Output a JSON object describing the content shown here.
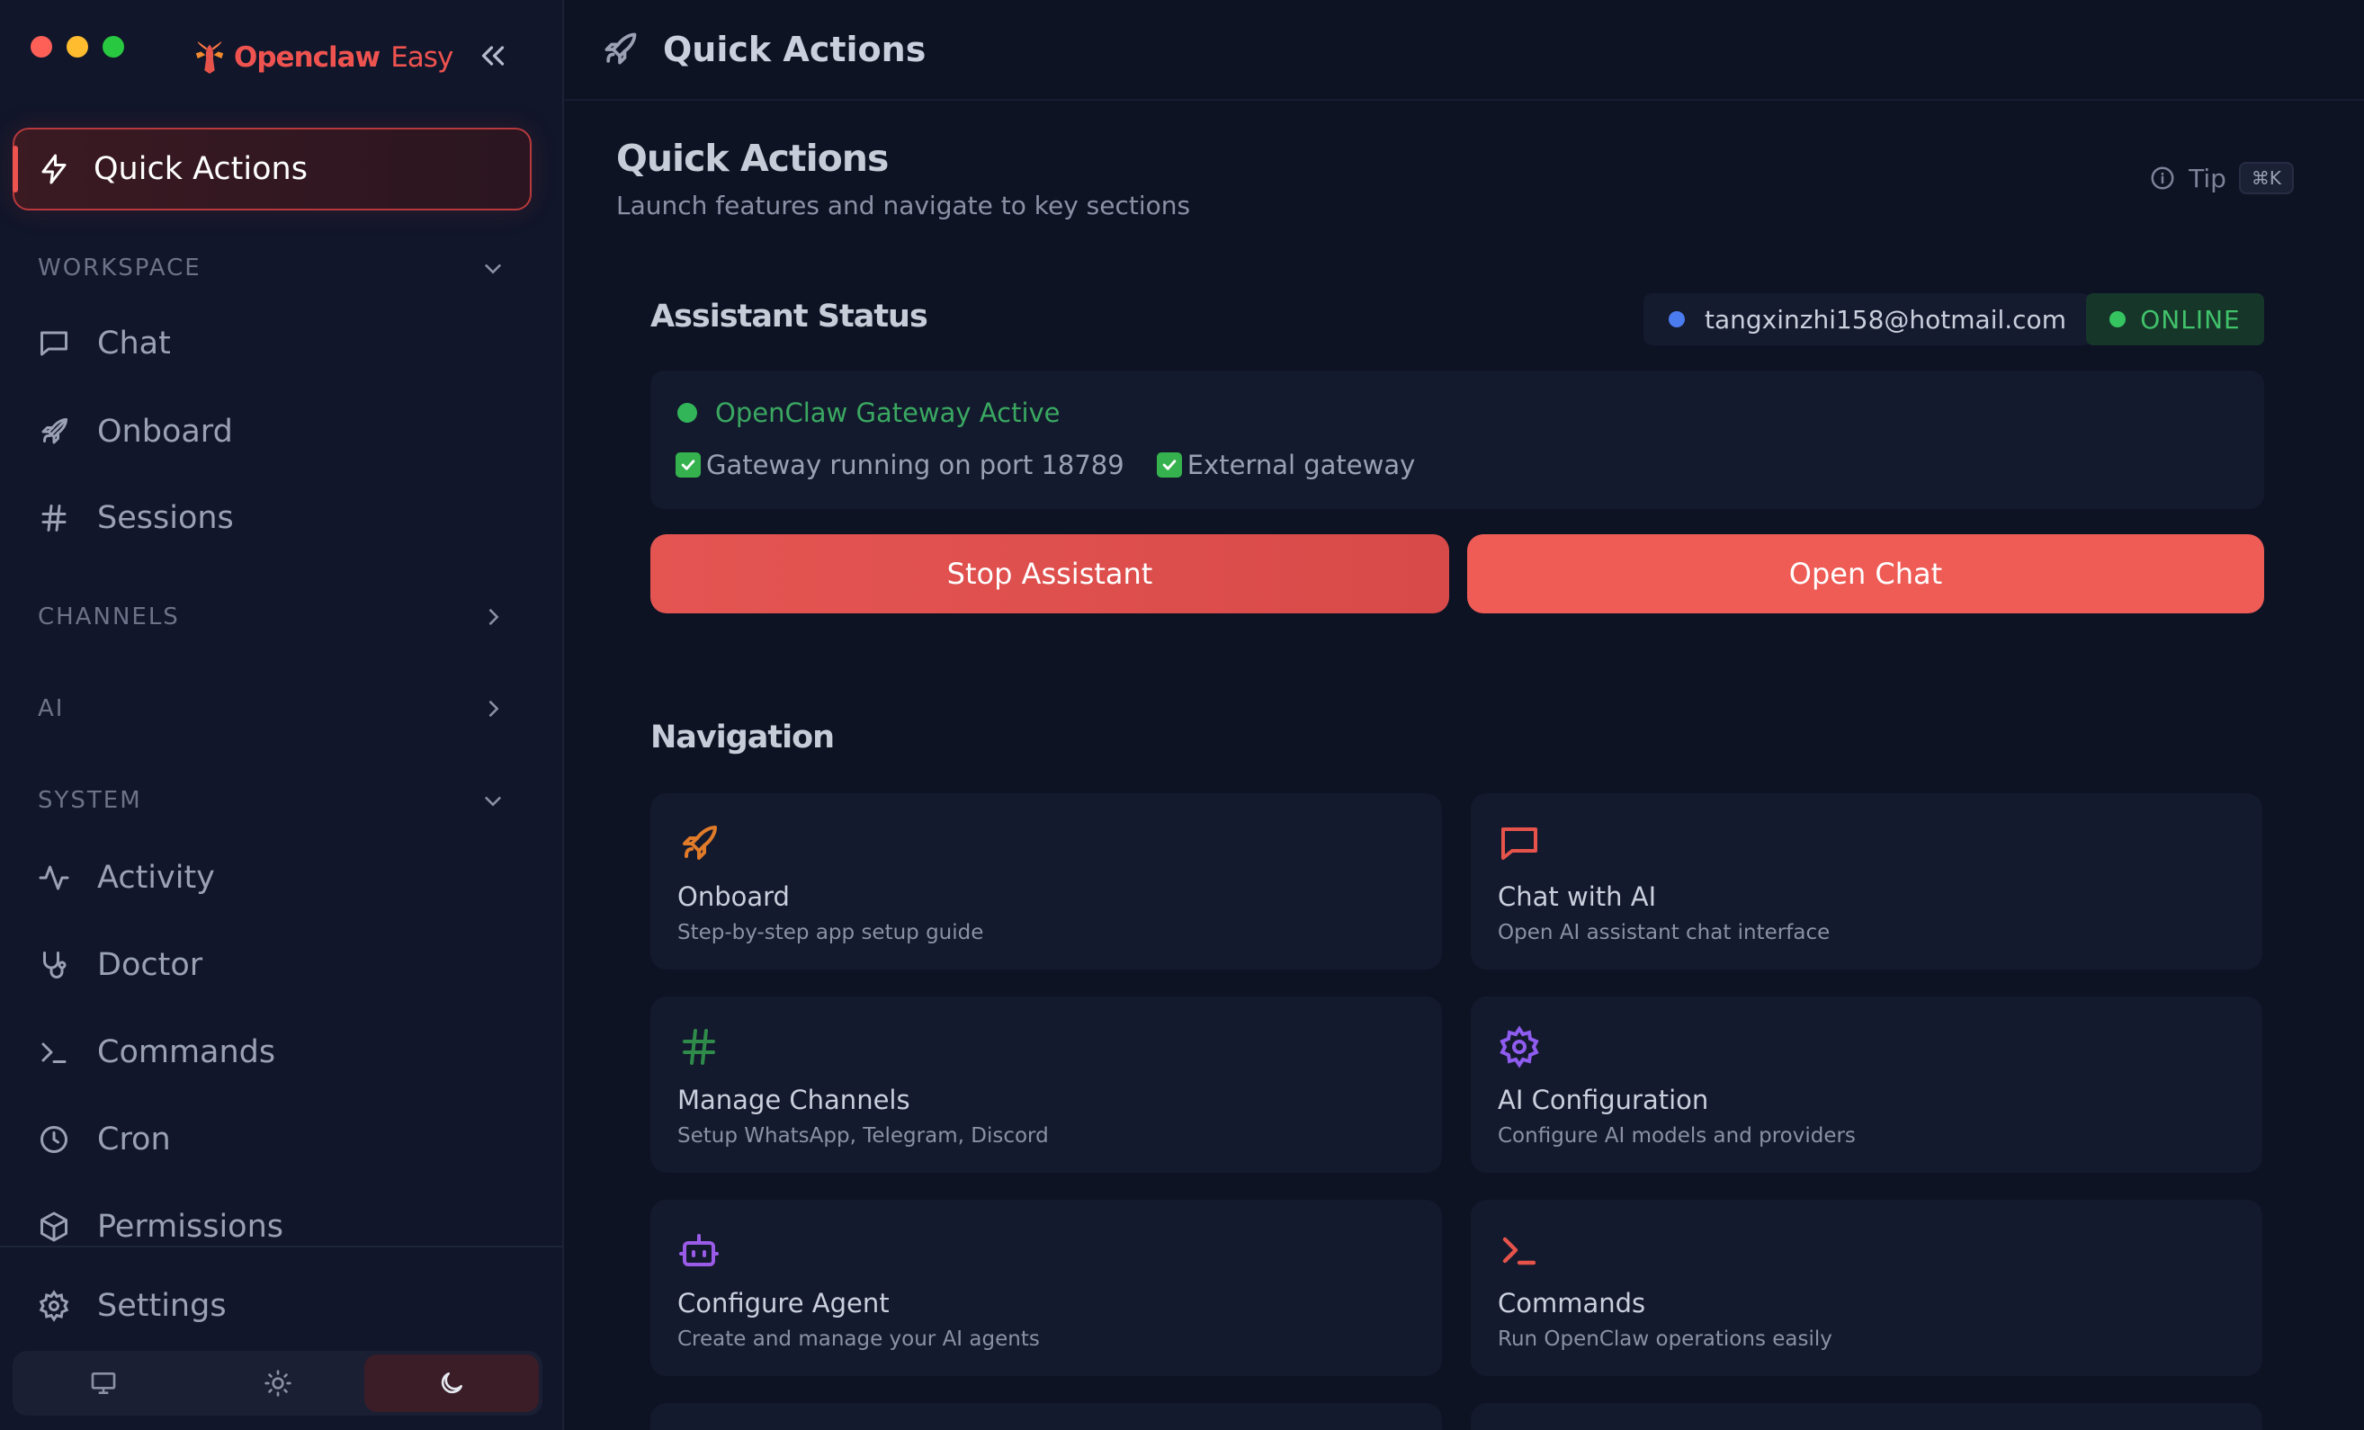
{
  "app": {
    "brand_name": "Openclaw",
    "brand_suffix": "Easy"
  },
  "sidebar": {
    "quick_actions_label": "Quick Actions",
    "sections": {
      "workspace": "WORKSPACE",
      "channels": "CHANNELS",
      "ai": "AI",
      "system": "SYSTEM"
    },
    "workspace_items": [
      "Chat",
      "Onboard",
      "Sessions"
    ],
    "system_items": [
      "Activity",
      "Doctor",
      "Commands",
      "Cron",
      "Permissions"
    ],
    "settings_label": "Settings",
    "theme_options": [
      "monitor-icon",
      "sun-icon",
      "moon-icon"
    ],
    "active_theme": "dark"
  },
  "topbar": {
    "title": "Quick Actions"
  },
  "page": {
    "title": "Quick Actions",
    "subtitle": "Launch features and navigate to key sections",
    "tip_label": "Tip",
    "tip_shortcut": "⌘K"
  },
  "assistant": {
    "title": "Assistant Status",
    "email": "tangxinzhi158@hotmail.com",
    "status": "ONLINE",
    "gateway_status": "OpenClaw Gateway Active",
    "checks": [
      "Gateway running on port 18789",
      "External gateway"
    ],
    "stop_button": "Stop Assistant",
    "open_chat_button": "Open Chat"
  },
  "navigation": {
    "title": "Navigation",
    "cards": [
      {
        "title": "Onboard",
        "subtitle": "Step-by-step app setup guide",
        "icon": "rocket-icon",
        "color": "#e07b2a"
      },
      {
        "title": "Chat with AI",
        "subtitle": "Open AI assistant chat interface",
        "icon": "message-icon",
        "color": "#e5534b"
      },
      {
        "title": "Manage Channels",
        "subtitle": "Setup WhatsApp, Telegram, Discord",
        "icon": "hash-icon",
        "color": "#2e8b4a"
      },
      {
        "title": "AI Configuration",
        "subtitle": "Configure AI models and providers",
        "icon": "gear-icon",
        "color": "#8f5cf0"
      },
      {
        "title": "Configure Agent",
        "subtitle": "Create and manage your AI agents",
        "icon": "bot-icon",
        "color": "#9a5ce8"
      },
      {
        "title": "Commands",
        "subtitle": "Run OpenClaw operations easily",
        "icon": "terminal-icon",
        "color": "#e5534b"
      }
    ]
  },
  "colors": {
    "accent": "#ef5350",
    "online": "#36c461",
    "background": "#0e1324"
  }
}
